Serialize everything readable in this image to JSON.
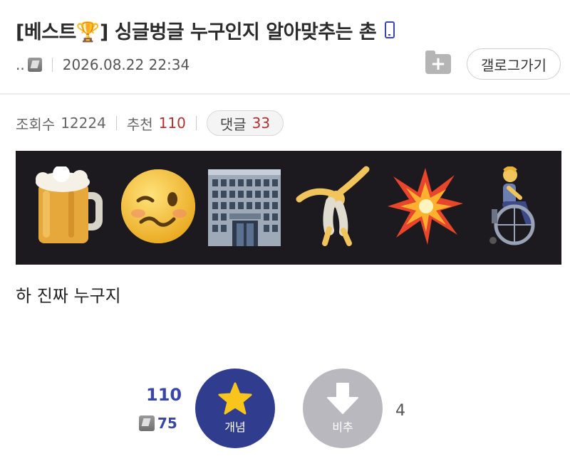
{
  "post": {
    "title": "[베스트🏆] 싱글벙글 누구인지 알아맞추는 촌",
    "author": "..",
    "datetime": "2026.08.22 22:34",
    "body": "하 진짜 누구지"
  },
  "header": {
    "gallery_button": "갤로그가기",
    "folder_plus": "+"
  },
  "stats": {
    "views_label": "조회수",
    "views": "12224",
    "recommend_label": "추천",
    "recommend": "110",
    "comments_label": "댓글",
    "comments": "33"
  },
  "emojis": [
    "beer-mug",
    "woozy-face",
    "office-building",
    "cartwheel-person",
    "collision",
    "person-in-wheelchair"
  ],
  "vote": {
    "up_count": "110",
    "fixed_count": "75",
    "up_label": "개념",
    "down_label": "비추",
    "down_count": "4"
  },
  "colors": {
    "accent": "#303d8f",
    "recommend_red": "#b03030",
    "banner_bg": "#1c1a1f",
    "downvote_gray": "#b9b8be"
  }
}
